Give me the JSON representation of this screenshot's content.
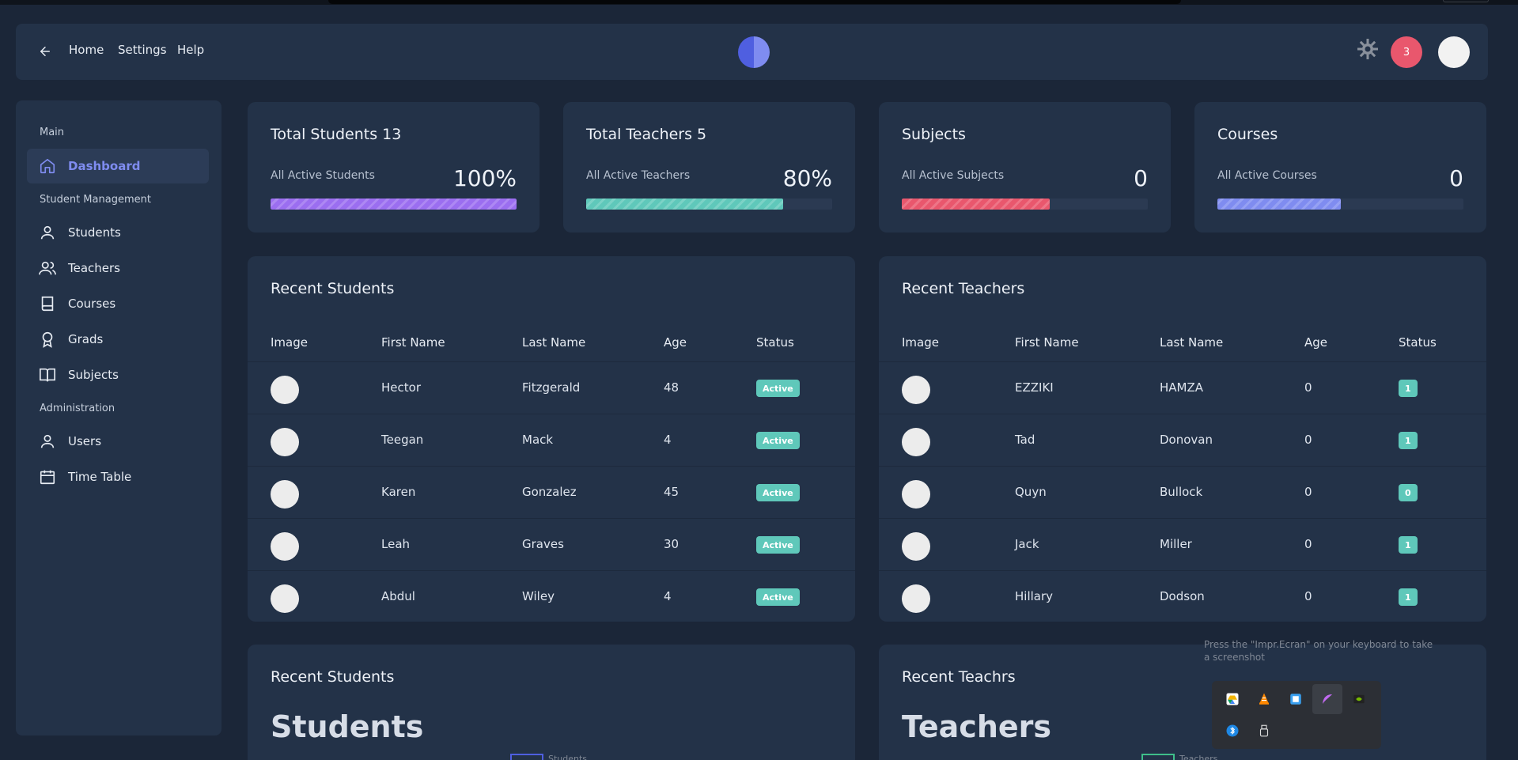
{
  "header": {
    "nav": [
      "Home",
      "Settings",
      "Help"
    ],
    "notifications": "3",
    "icons": {
      "back": "arrow-left-icon",
      "theme": "sun-gear-icon"
    }
  },
  "sidebar": {
    "sections": [
      {
        "title": "Main",
        "items": [
          {
            "label": "Dashboard",
            "icon": "home-icon",
            "active": true
          }
        ]
      },
      {
        "title": "Student Management",
        "items": [
          {
            "label": "Students",
            "icon": "user-icon"
          },
          {
            "label": "Teachers",
            "icon": "users-icon"
          },
          {
            "label": "Courses",
            "icon": "book-icon"
          },
          {
            "label": "Grads",
            "icon": "award-icon"
          },
          {
            "label": "Subjects",
            "icon": "book-open-icon"
          }
        ]
      },
      {
        "title": "Administration",
        "items": [
          {
            "label": "Users",
            "icon": "user-icon"
          },
          {
            "label": "Time Table",
            "icon": "calendar-icon"
          }
        ]
      }
    ]
  },
  "stats": [
    {
      "title": "Total Students 13",
      "subtitle": "All Active Students",
      "value": "100%",
      "progress": 1.0,
      "color": "#9b6ef0"
    },
    {
      "title": "Total Teachers 5",
      "subtitle": "All Active Teachers",
      "value": "80%",
      "progress": 0.8,
      "color": "#5fc8ba"
    },
    {
      "title": "Subjects",
      "subtitle": "All Active Subjects",
      "value": "0",
      "progress": 0.6,
      "color": "#e9576d"
    },
    {
      "title": "Courses",
      "subtitle": "All Active Courses",
      "value": "0",
      "progress": 0.5,
      "color": "#7f8cf0"
    }
  ],
  "recent_students": {
    "title": "Recent Students",
    "columns": [
      "Image",
      "First Name",
      "Last Name",
      "Age",
      "Status"
    ],
    "rows": [
      {
        "first": "Hector",
        "last": "Fitzgerald",
        "age": "48",
        "status": "Active"
      },
      {
        "first": "Teegan",
        "last": "Mack",
        "age": "4",
        "status": "Active"
      },
      {
        "first": "Karen",
        "last": "Gonzalez",
        "age": "45",
        "status": "Active"
      },
      {
        "first": "Leah",
        "last": "Graves",
        "age": "30",
        "status": "Active"
      },
      {
        "first": "Abdul",
        "last": "Wiley",
        "age": "4",
        "status": "Active"
      }
    ]
  },
  "recent_teachers": {
    "title": "Recent Teachers",
    "columns": [
      "Image",
      "First Name",
      "Last Name",
      "Age",
      "Status"
    ],
    "rows": [
      {
        "first": "EZZIKI",
        "last": "HAMZA",
        "age": "0",
        "status": "1"
      },
      {
        "first": "Tad",
        "last": "Donovan",
        "age": "0",
        "status": "1"
      },
      {
        "first": "Quyn",
        "last": "Bullock",
        "age": "0",
        "status": "0"
      },
      {
        "first": "Jack",
        "last": "Miller",
        "age": "0",
        "status": "1"
      },
      {
        "first": "Hillary",
        "last": "Dodson",
        "age": "0",
        "status": "1"
      }
    ]
  },
  "chart_cards": [
    {
      "title": "Recent Students",
      "big_title": "Students",
      "legend": "Students",
      "legend_color": "#4f5fe0"
    },
    {
      "title": "Recent Teachrs",
      "big_title": "Teachers",
      "legend": "Teachers",
      "legend_color": "#3fbf8a"
    }
  ],
  "tooltip": "Press the \"Impr.Ecran\" on your keyboard to take a screenshot",
  "tray_icons": [
    "google-drive-icon",
    "vlc-icon",
    "window-icon",
    "feather-icon",
    "nvidia-icon",
    "bluetooth-icon",
    "usb-icon"
  ]
}
